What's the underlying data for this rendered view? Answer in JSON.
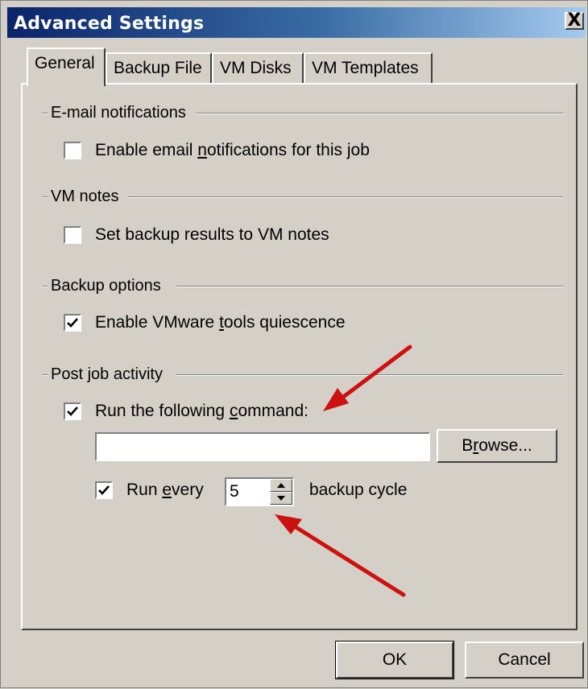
{
  "window": {
    "title": "Advanced Settings",
    "close_label": "X"
  },
  "tabs": [
    {
      "label": "General",
      "active": true
    },
    {
      "label": "Backup File",
      "active": false
    },
    {
      "label": "VM Disks",
      "active": false
    },
    {
      "label": "VM Templates",
      "active": false
    }
  ],
  "groups": {
    "email": {
      "title": "E-mail notifications",
      "checkbox_label_pre": "Enable email ",
      "checkbox_label_ul": "n",
      "checkbox_label_post": "otifications for this job",
      "checked": false
    },
    "vm_notes": {
      "title": "VM notes",
      "checkbox_label": "Set backup results to VM notes",
      "checked": false
    },
    "backup_options": {
      "title": "Backup options",
      "checkbox_label_pre": "Enable VMware ",
      "checkbox_label_ul": "t",
      "checkbox_label_post": "ools quiescence",
      "checked": true
    },
    "post_job": {
      "title": "Post job activity",
      "run_command_pre": "Run the following ",
      "run_command_ul": "c",
      "run_command_post": "ommand:",
      "run_command_checked": true,
      "command_value": "",
      "browse_pre": "B",
      "browse_ul": "r",
      "browse_post": "owse...",
      "run_every_pre": "Run ",
      "run_every_ul": "e",
      "run_every_post": "very",
      "run_every_checked": true,
      "cycle_value": "5",
      "cycle_suffix": "backup cycle"
    }
  },
  "footer": {
    "ok_label": "OK",
    "cancel_label": "Cancel"
  },
  "colors": {
    "title_gradient_start": "#0a246a",
    "title_gradient_end": "#a6caf0",
    "face": "#d4d0c8",
    "annotation_arrow": "#cc1111"
  },
  "icons": {
    "check": "check-icon",
    "spin_up": "spin-up-icon",
    "spin_down": "spin-down-icon",
    "arrow": "annotation-arrow-icon"
  }
}
